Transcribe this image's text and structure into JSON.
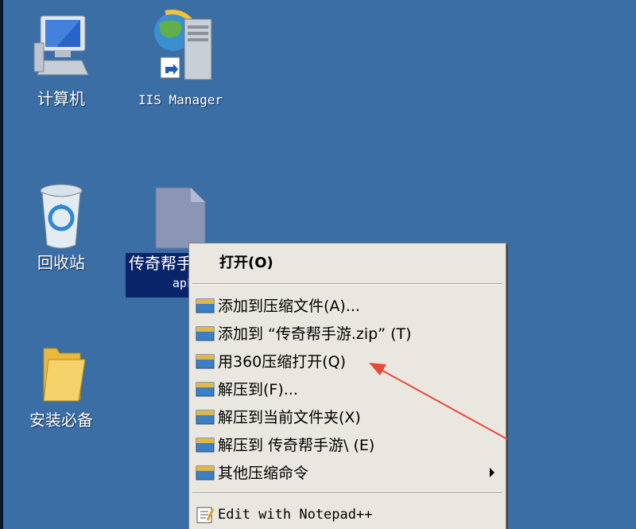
{
  "desktop": {
    "background_color": "#3a6ea5",
    "icons": [
      {
        "label": "计算机",
        "icon": "computer-icon"
      },
      {
        "label": "IIS Manager",
        "icon": "iis-manager-icon"
      },
      {
        "label": "回收站",
        "icon": "recycle-bin-icon"
      },
      {
        "label": "安装必备",
        "icon": "folder-icon"
      }
    ],
    "selected_file": {
      "label_line1": "传奇帮手",
      "label_line2": "apk",
      "icon": "file-icon"
    }
  },
  "context_menu": {
    "header": "打开(O)",
    "items": [
      {
        "label": "添加到压缩文件(A)...",
        "icon": "archive-icon"
      },
      {
        "label": "添加到 “传奇帮手游.zip” (T)",
        "icon": "archive-icon"
      },
      {
        "label": "用360压缩打开(Q)",
        "icon": "archive-icon"
      },
      {
        "label": "解压到(F)...",
        "icon": "archive-icon"
      },
      {
        "label": "解压到当前文件夹(X)",
        "icon": "archive-icon"
      },
      {
        "label": "解压到 传奇帮手游\\ (E)",
        "icon": "archive-icon"
      },
      {
        "label": "其他压缩命令",
        "icon": "archive-icon",
        "submenu": true
      },
      {
        "label": "Edit with Notepad++",
        "icon": "notepad-plus-plus-icon"
      }
    ]
  },
  "annotation": {
    "color": "#e84a3a"
  }
}
